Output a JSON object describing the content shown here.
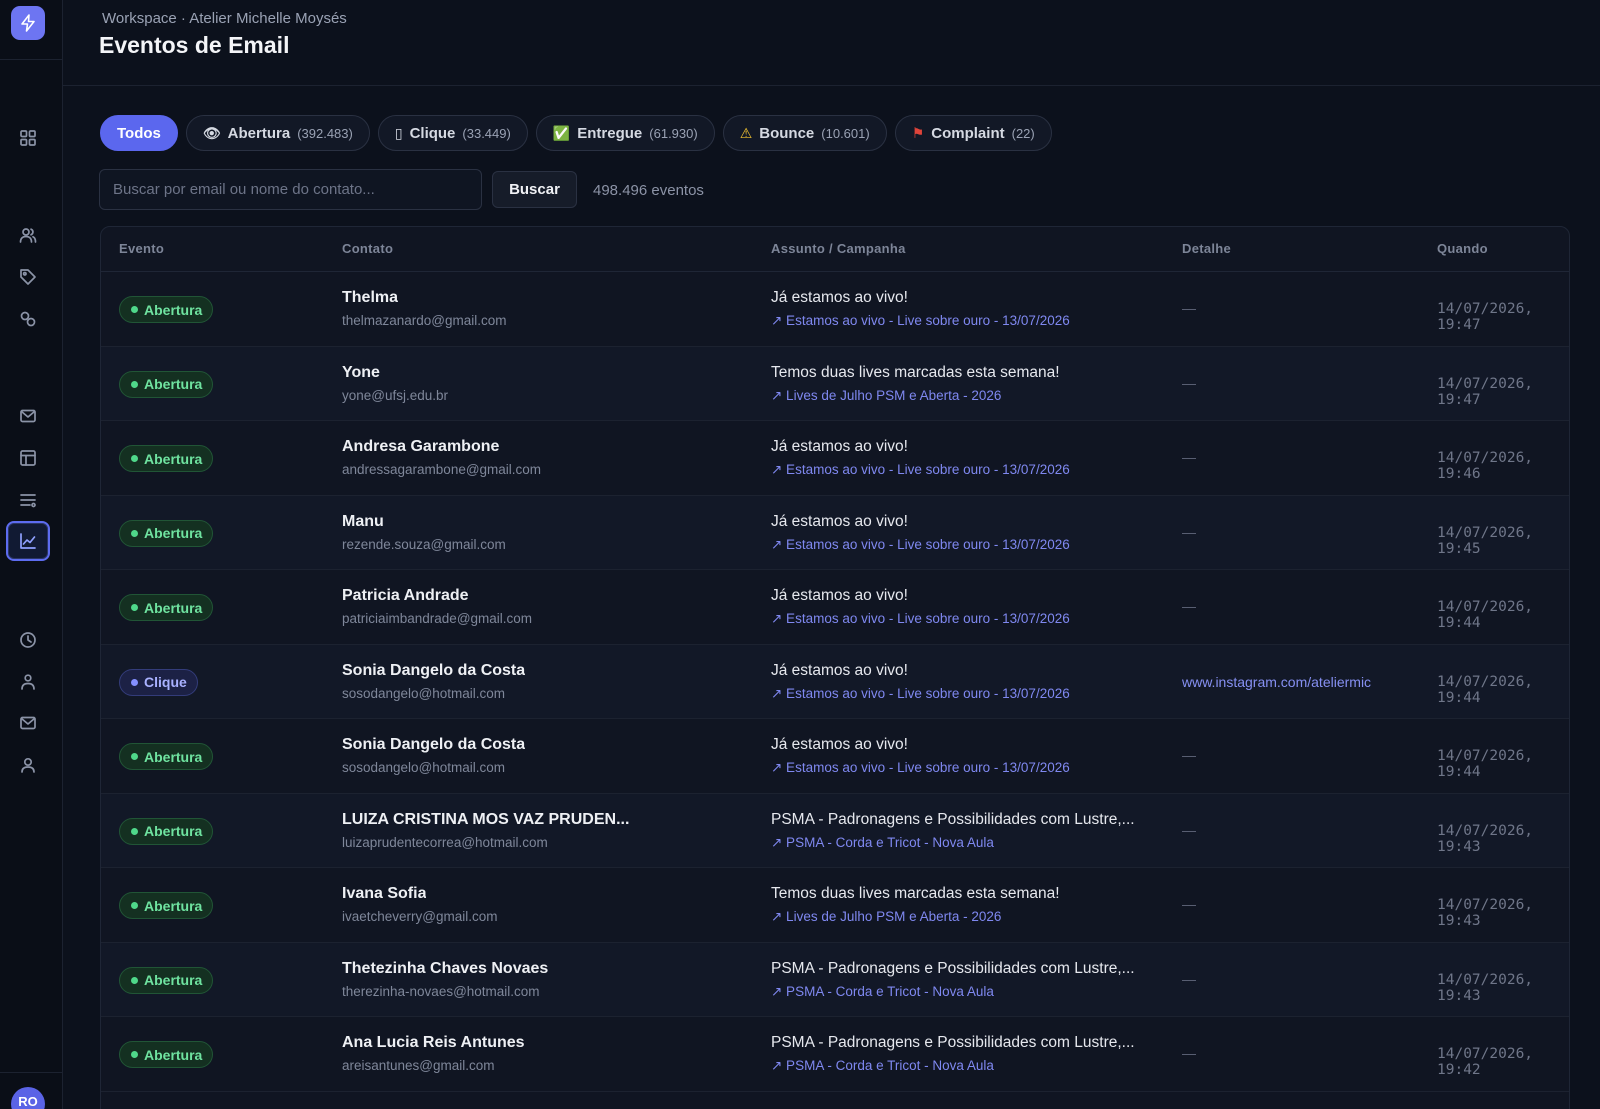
{
  "sidebar": {
    "avatar_initials": "RO",
    "items": [
      {
        "icon": "grid-icon",
        "name": "nav-dashboard"
      },
      {
        "icon": "users-icon",
        "name": "nav-contacts"
      },
      {
        "icon": "tag-icon",
        "name": "nav-tags"
      },
      {
        "icon": "segments-icon",
        "name": "nav-segments"
      },
      {
        "icon": "mail-icon",
        "name": "nav-campaigns"
      },
      {
        "icon": "layout-icon",
        "name": "nav-templates"
      },
      {
        "icon": "list-icon",
        "name": "nav-lists"
      },
      {
        "icon": "chart-icon",
        "name": "nav-events",
        "active": true
      },
      {
        "icon": "clock-icon",
        "name": "nav-history"
      },
      {
        "icon": "people-icon",
        "name": "nav-team"
      },
      {
        "icon": "envelope-icon",
        "name": "nav-senders"
      },
      {
        "icon": "user-icon",
        "name": "nav-profile"
      }
    ]
  },
  "header": {
    "breadcrumb": "Workspace · Atelier Michelle Moysés",
    "title": "Eventos de Email"
  },
  "filters": [
    {
      "label": "Todos",
      "count": "",
      "icon": "",
      "active": true
    },
    {
      "label": "Abertura",
      "count": "(392.483)",
      "icon": "👁"
    },
    {
      "label": "Clique",
      "count": "(33.449)",
      "icon": "▯"
    },
    {
      "label": "Entregue",
      "count": "(61.930)",
      "icon": "✅"
    },
    {
      "label": "Bounce",
      "count": "(10.601)",
      "icon": "⚠"
    },
    {
      "label": "Complaint",
      "count": "(22)",
      "icon": "⚑"
    }
  ],
  "search": {
    "placeholder": "Buscar por email ou nome do contato...",
    "value": "",
    "button_label": "Buscar",
    "result_count": "498.496 eventos"
  },
  "table": {
    "columns": [
      "Evento",
      "Contato",
      "Assunto / Campanha",
      "Detalhe",
      "Quando"
    ],
    "rows": [
      {
        "event": "Abertura",
        "type": "abertura",
        "name": "Thelma",
        "email": "thelmazanardo@gmail.com",
        "subject": "Já estamos ao vivo!",
        "campaign": "↗ Estamos ao vivo - Live sobre ouro - 13/07/2026",
        "detail": "—",
        "when": "14/07/2026, 19:47"
      },
      {
        "event": "Abertura",
        "type": "abertura",
        "name": "Yone",
        "email": "yone@ufsj.edu.br",
        "subject": "Temos duas lives marcadas esta semana!",
        "campaign": "↗ Lives de Julho PSM e Aberta - 2026",
        "detail": "—",
        "when": "14/07/2026, 19:47"
      },
      {
        "event": "Abertura",
        "type": "abertura",
        "name": "Andresa Garambone",
        "email": "andressagarambone@gmail.com",
        "subject": "Já estamos ao vivo!",
        "campaign": "↗ Estamos ao vivo - Live sobre ouro - 13/07/2026",
        "detail": "—",
        "when": "14/07/2026, 19:46"
      },
      {
        "event": "Abertura",
        "type": "abertura",
        "name": "Manu",
        "email": "rezende.souza@gmail.com",
        "subject": "Já estamos ao vivo!",
        "campaign": "↗ Estamos ao vivo - Live sobre ouro - 13/07/2026",
        "detail": "—",
        "when": "14/07/2026, 19:45"
      },
      {
        "event": "Abertura",
        "type": "abertura",
        "name": "Patricia Andrade",
        "email": "patriciaimbandrade@gmail.com",
        "subject": "Já estamos ao vivo!",
        "campaign": "↗ Estamos ao vivo - Live sobre ouro - 13/07/2026",
        "detail": "—",
        "when": "14/07/2026, 19:44"
      },
      {
        "event": "Clique",
        "type": "clique",
        "name": "Sonia Dangelo da Costa",
        "email": "sosodangelo@hotmail.com",
        "subject": "Já estamos ao vivo!",
        "campaign": "↗ Estamos ao vivo - Live sobre ouro - 13/07/2026",
        "detail": "www.instagram.com/ateliermic",
        "detail_link": true,
        "when": "14/07/2026, 19:44"
      },
      {
        "event": "Abertura",
        "type": "abertura",
        "name": "Sonia Dangelo da Costa",
        "email": "sosodangelo@hotmail.com",
        "subject": "Já estamos ao vivo!",
        "campaign": "↗ Estamos ao vivo - Live sobre ouro - 13/07/2026",
        "detail": "—",
        "when": "14/07/2026, 19:44"
      },
      {
        "event": "Abertura",
        "type": "abertura",
        "name": "LUIZA CRISTINA MOS VAZ PRUDEN...",
        "email": "luizaprudentecorrea@hotmail.com",
        "subject": "PSMA - Padronagens e Possibilidades com Lustre,...",
        "campaign": "↗ PSMA - Corda e Tricot - Nova Aula",
        "detail": "—",
        "when": "14/07/2026, 19:43"
      },
      {
        "event": "Abertura",
        "type": "abertura",
        "name": "Ivana Sofia",
        "email": "ivaetcheverry@gmail.com",
        "subject": "Temos duas lives marcadas esta semana!",
        "campaign": "↗ Lives de Julho PSM e Aberta - 2026",
        "detail": "—",
        "when": "14/07/2026, 19:43"
      },
      {
        "event": "Abertura",
        "type": "abertura",
        "name": "Thetezinha Chaves Novaes",
        "email": "therezinha-novaes@hotmail.com",
        "subject": "PSMA - Padronagens e Possibilidades com Lustre,...",
        "campaign": "↗ PSMA - Corda e Tricot - Nova Aula",
        "detail": "—",
        "when": "14/07/2026, 19:43"
      },
      {
        "event": "Abertura",
        "type": "abertura",
        "name": "Ana Lucia Reis Antunes",
        "email": "areisantunes@gmail.com",
        "subject": "PSMA - Padronagens e Possibilidades com Lustre,...",
        "campaign": "↗ PSMA - Corda e Tricot - Nova Aula",
        "detail": "—",
        "when": "14/07/2026, 19:42"
      }
    ]
  },
  "colors": {
    "accent": "#5b67ee",
    "background": "#0c111c",
    "abertura": "#4fd88a",
    "clique": "#8590ff"
  }
}
